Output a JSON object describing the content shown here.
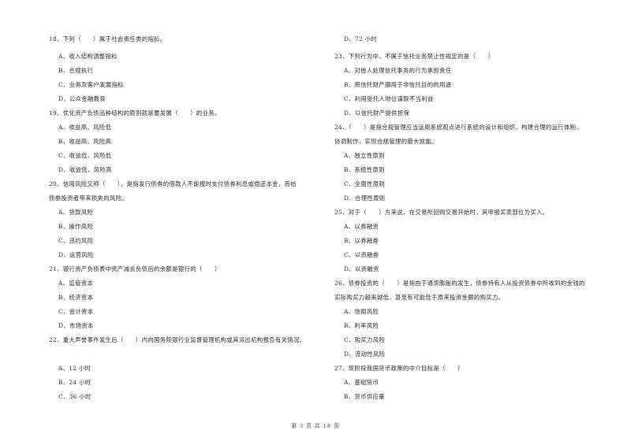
{
  "left_column": [
    {
      "type": "q",
      "text": "18、下列（　　）属于社会责任类的指标。"
    },
    {
      "type": "opt",
      "text": "A、收入结构调整指标"
    },
    {
      "type": "opt",
      "text": "B、合规执行"
    },
    {
      "type": "opt",
      "text": "C、业务及客户发展指标"
    },
    {
      "type": "opt",
      "text": "D、公众金融教育"
    },
    {
      "type": "q",
      "text": "19、优化资产负债品种结构的原则就是要发展（　　）的业务。"
    },
    {
      "type": "opt",
      "text": "A、收益高、风险低"
    },
    {
      "type": "opt",
      "text": "B、收益高、风险高"
    },
    {
      "type": "opt",
      "text": "C、收益低、风险低"
    },
    {
      "type": "opt",
      "text": "D、收益低、风险高"
    },
    {
      "type": "q",
      "text": "20、信用风险又称（　　），是指发行债券的借款人不能按时支付债券利息或偿还本金，而给"
    },
    {
      "type": "q",
      "text": "债券投资者带来损失的风险。"
    },
    {
      "type": "opt",
      "text": "A、贷款风险"
    },
    {
      "type": "opt",
      "text": "B、操作风险"
    },
    {
      "type": "opt",
      "text": "C、违约风险"
    },
    {
      "type": "opt",
      "text": "D、运营风险"
    },
    {
      "type": "q",
      "text": "21、银行资产负债表中资产减去负债后的余额是银行的（　　）"
    },
    {
      "type": "opt",
      "text": "A、监管资本"
    },
    {
      "type": "opt",
      "text": "B、经济资本"
    },
    {
      "type": "opt",
      "text": "C、会计资本"
    },
    {
      "type": "opt",
      "text": "D、市场资本"
    },
    {
      "type": "q",
      "text": "22、重大声誉事件发生后（　　）内向国务院银行业监督管理机构或其派出机构报告有关情况。"
    },
    {
      "type": "opt",
      "text": "A、12 小时"
    },
    {
      "type": "opt",
      "text": "B、24 小时"
    },
    {
      "type": "opt",
      "text": "C、36 小时"
    }
  ],
  "right_column": [
    {
      "type": "opt",
      "text": "D、72 小时"
    },
    {
      "type": "q",
      "text": "23、下列行为中，不属于信托业务禁止性规定的是（　　）"
    },
    {
      "type": "opt",
      "text": "A、对他人处理信托事务的行为承担责任"
    },
    {
      "type": "opt",
      "text": "B、将信托财产挪用于非信托目的的用途"
    },
    {
      "type": "opt",
      "text": "C、利用受托人地位谋取不当利益"
    },
    {
      "type": "opt",
      "text": "D、以信托财产提供担保"
    },
    {
      "type": "q",
      "text": "24、（　　）是指合规管理应当运用系统观点进行系统的设计和组织，构建合理的运行体制，"
    },
    {
      "type": "q",
      "text": "协调制作，实现合规管理的最大效能。"
    },
    {
      "type": "opt",
      "text": "A、独立性原则"
    },
    {
      "type": "opt",
      "text": "B、系统性原则"
    },
    {
      "type": "opt",
      "text": "C、全面性原则"
    },
    {
      "type": "opt",
      "text": "D、合理性原则"
    },
    {
      "type": "q",
      "text": "25、对于（　　）方来说，在交易所回购交易开始时，其申报买卖部位为买入。"
    },
    {
      "type": "opt",
      "text": "A、以券融资"
    },
    {
      "type": "opt",
      "text": "B、以券融券"
    },
    {
      "type": "opt",
      "text": "C、以资融券"
    },
    {
      "type": "opt",
      "text": "D、以资融资"
    },
    {
      "type": "q",
      "text": "26、债券投资的（　　）是指由于通货膨胀的发生，债券持有人从投资债券中所收到的金钱的"
    },
    {
      "type": "q",
      "text": "实际购买力越来越低，甚至有可能低于原来投资金额的购买力。"
    },
    {
      "type": "opt",
      "text": "A、信用风险"
    },
    {
      "type": "opt",
      "text": "B、利率风险"
    },
    {
      "type": "opt",
      "text": "C、购买力风险"
    },
    {
      "type": "opt",
      "text": "D、流动性风险"
    },
    {
      "type": "q",
      "text": "27、现阶段我国货币政策的中介目标是（　　）"
    },
    {
      "type": "opt",
      "text": "A、基础货币"
    },
    {
      "type": "opt",
      "text": "B、货币供应量"
    }
  ],
  "footer": {
    "page_label": "第 3 页 共 18 页"
  }
}
